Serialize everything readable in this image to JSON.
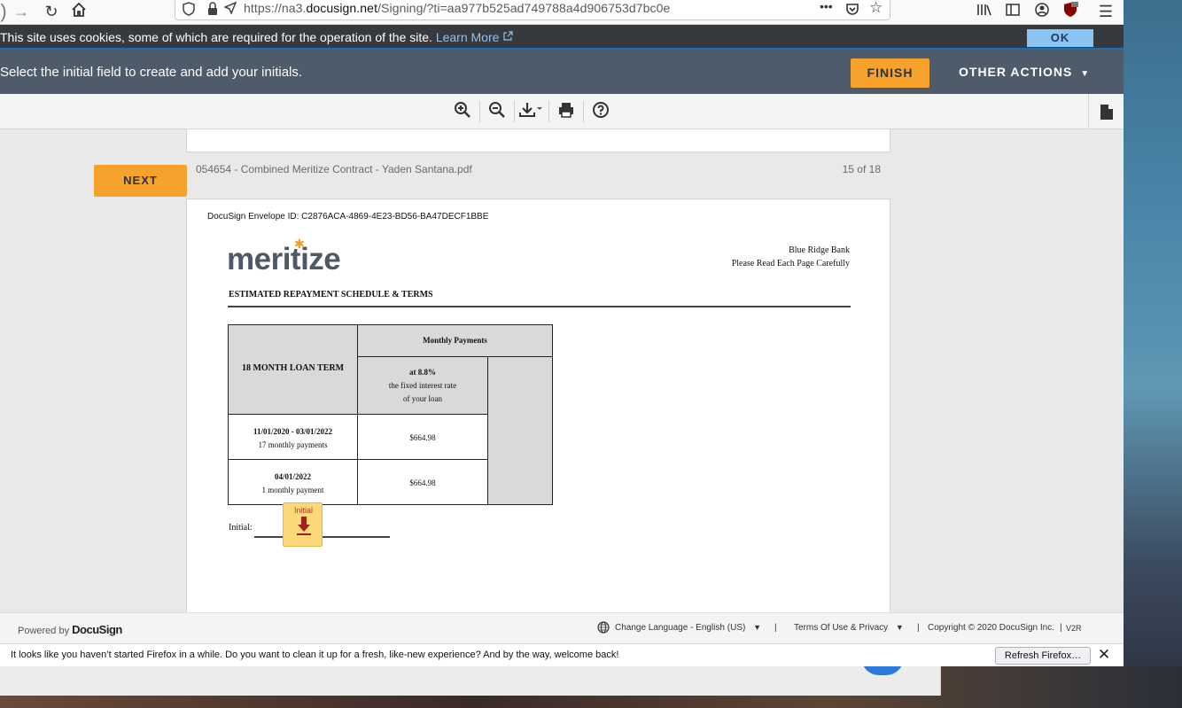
{
  "browser": {
    "url_prefix": "https://na3.",
    "url_domain": "docusign.net",
    "url_path": "/Signing/?ti=aa977b525ad749788a4d906753d7bc0e",
    "more_icon": "•••"
  },
  "cookie_bar": {
    "text": "This site uses cookies, some of which are required for the operation of the site.",
    "link": "Learn More",
    "ok_label": "OK"
  },
  "header": {
    "instruction": "Select the initial field to create and add your initials.",
    "finish_label": "FINISH",
    "other_actions_label": "OTHER ACTIONS"
  },
  "viewer": {
    "next_label": "NEXT",
    "doc_name": "054654 - Combined Meritize Contract - Yaden Santana.pdf",
    "page_count": "15 of 18"
  },
  "document": {
    "envelope_id": "DocuSign Envelope ID: C2876ACA-4869-4E23-BD56-BA47DECF1BBE",
    "logo": "meritize",
    "bank_name": "Blue Ridge Bank",
    "read_carefully": "Please Read Each Page Carefully",
    "section_title": "ESTIMATED REPAYMENT SCHEDULE & TERMS",
    "table": {
      "loan_term": "18 MONTH LOAN TERM",
      "monthly_payments": "Monthly Payments",
      "rate": "at 8.8%",
      "rate_desc_1": "the fixed interest rate",
      "rate_desc_2": "of your loan",
      "rows": [
        {
          "period": "11/01/2020 - 03/01/2022",
          "count": "17 monthly payments",
          "amount": "$664.98"
        },
        {
          "period": "04/01/2022",
          "count": "1 monthly payment",
          "amount": "$664.98"
        }
      ]
    },
    "initial_label": "Initial:",
    "initial_tag": "Initial"
  },
  "footer": {
    "powered_by": "Powered by",
    "brand": "DocuSign",
    "language": "Change Language - English (US)",
    "terms": "Terms Of Use & Privacy",
    "copyright": "Copyright © 2020 DocuSign Inc.",
    "version": "V2R",
    "sep": "|"
  },
  "notification": {
    "text": "It looks like you haven’t started Firefox in a while. Do you want to clean it up for a fresh, like-new experience? And by the way, welcome back!",
    "refresh_label": "Refresh Firefox…"
  }
}
